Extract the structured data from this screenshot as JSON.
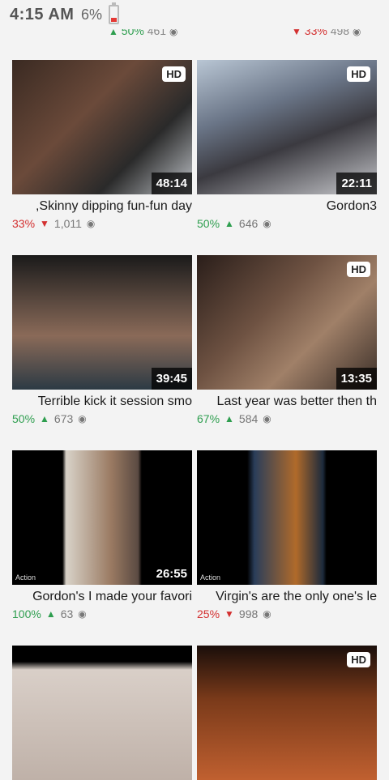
{
  "status_bar": {
    "time": "4:15 AM",
    "battery": "6%"
  },
  "previous_row": [
    {
      "views": "461",
      "rating": "50%"
    },
    {
      "views": "498",
      "rating": "33%"
    }
  ],
  "videos": [
    {
      "title": "Skinny dipping fun-fun day,",
      "duration": "48:14",
      "hd": "HD",
      "views": "1,011",
      "rating": "33%",
      "rating_type": "bad"
    },
    {
      "title": "Gordon3",
      "duration": "22:11",
      "hd": "HD",
      "views": "646",
      "rating": "50%",
      "rating_type": "good"
    },
    {
      "title": "Terrible kick it session smo",
      "duration": "39:45",
      "hd": "",
      "views": "673",
      "rating": "50%",
      "rating_type": "good"
    },
    {
      "title": "Last year was better then th",
      "duration": "13:35",
      "hd": "HD",
      "views": "584",
      "rating": "67%",
      "rating_type": "good"
    },
    {
      "title": "Gordon's I made your favori",
      "duration": "26:55",
      "hd": "",
      "views": "63",
      "rating": "100%",
      "rating_type": "good",
      "watermark": "Action"
    },
    {
      "title": "Virgin's are the only one's le",
      "duration": "",
      "hd": "",
      "views": "998",
      "rating": "25%",
      "rating_type": "bad",
      "watermark": "Action"
    },
    {
      "title": "",
      "duration": "",
      "hd": "",
      "views": "",
      "rating": ""
    },
    {
      "title": "",
      "duration": "",
      "hd": "HD",
      "views": "",
      "rating": ""
    }
  ]
}
